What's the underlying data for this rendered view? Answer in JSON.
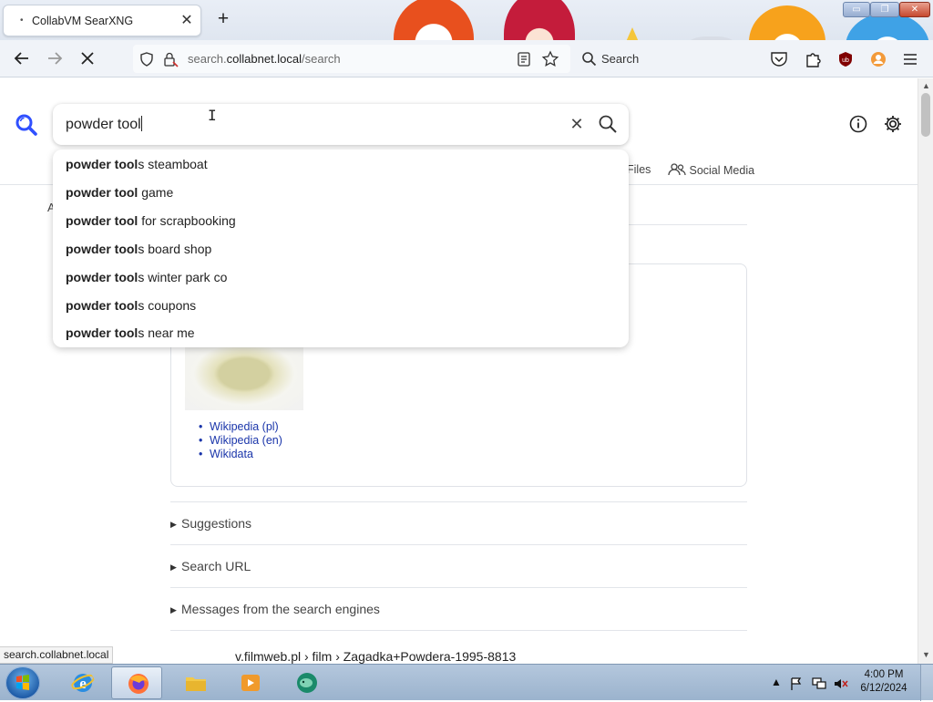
{
  "browser": {
    "tab_title": "CollabVM SearXNG",
    "tab_dot": "•",
    "tab_close": "✕",
    "new_tab": "+",
    "url_host": "search.",
    "url_domain": "collabnet.local",
    "url_path": "/search",
    "search_label": "Search",
    "win_min": "▭",
    "win_max": "❐",
    "win_close": "✕"
  },
  "search": {
    "query": "powder tool",
    "clear_icon": "✕"
  },
  "autocomplete": [
    {
      "bold": "powder tool",
      "rest": "s steamboat"
    },
    {
      "bold": "powder tool",
      "rest": " game"
    },
    {
      "bold": "powder tool",
      "rest": " for scrapbooking"
    },
    {
      "bold": "powder tool",
      "rest": "s board shop"
    },
    {
      "bold": "powder tool",
      "rest": "s winter park co"
    },
    {
      "bold": "powder tool",
      "rest": "s coupons"
    },
    {
      "bold": "powder tool",
      "rest": "s near me"
    }
  ],
  "categories": {
    "files_partial": "Files",
    "social_media": "Social Media"
  },
  "results": {
    "partial_letter": "A",
    "infobox_links": [
      "Wikipedia (pl)",
      "Wikipedia (en)",
      "Wikidata"
    ],
    "expanders": [
      "Suggestions",
      "Search URL",
      "Messages from the search engines"
    ],
    "partial_result": "v.filmweb.pl  › film › Zagadka+Powdera-1995-8813"
  },
  "status_url": "search.collabnet.local",
  "taskbar": {
    "time": "4:00 PM",
    "date": "6/12/2024"
  },
  "colors": {
    "accent": "#3050ff",
    "link": "#1a35aa"
  }
}
